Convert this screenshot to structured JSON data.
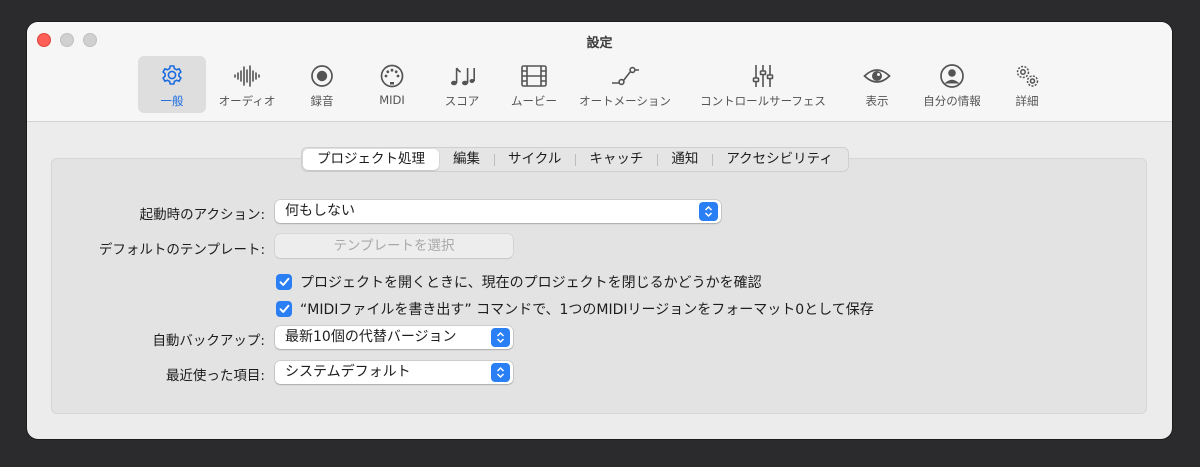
{
  "window": {
    "title": "設定"
  },
  "toolbar": {
    "items": [
      {
        "label": "一般",
        "icon": "gear-icon",
        "active": true
      },
      {
        "label": "オーディオ",
        "icon": "waveform-icon"
      },
      {
        "label": "録音",
        "icon": "record-icon"
      },
      {
        "label": "MIDI",
        "icon": "midi-connector-icon"
      },
      {
        "label": "スコア",
        "icon": "music-notes-icon"
      },
      {
        "label": "ムービー",
        "icon": "film-icon"
      },
      {
        "label": "オートメーション",
        "icon": "automation-curve-icon"
      },
      {
        "label": "コントロールサーフェス",
        "icon": "sliders-icon"
      },
      {
        "label": "表示",
        "icon": "eye-icon"
      },
      {
        "label": "自分の情報",
        "icon": "person-icon"
      },
      {
        "label": "詳細",
        "icon": "gears-icon"
      }
    ]
  },
  "tabs": [
    "プロジェクト処理",
    "編集",
    "サイクル",
    "キャッチ",
    "通知",
    "アクセシビリティ"
  ],
  "settings": {
    "startup_label": "起動時のアクション:",
    "startup_value": "何もしない",
    "template_label": "デフォルトのテンプレート:",
    "template_button": "テンプレートを選択",
    "check1": "プロジェクトを開くときに、現在のプロジェクトを閉じるかどうかを確認",
    "check2": "“MIDIファイルを書き出す” コマンドで、1つのMIDIリージョンをフォーマット0として保存",
    "backup_label": "自動バックアップ:",
    "backup_value": "最新10個の代替バージョン",
    "recent_label": "最近使った項目:",
    "recent_value": "システムデフォルト"
  },
  "colors": {
    "accent": "#2a7ff5",
    "active_toolbar_text": "#1a6be0"
  }
}
